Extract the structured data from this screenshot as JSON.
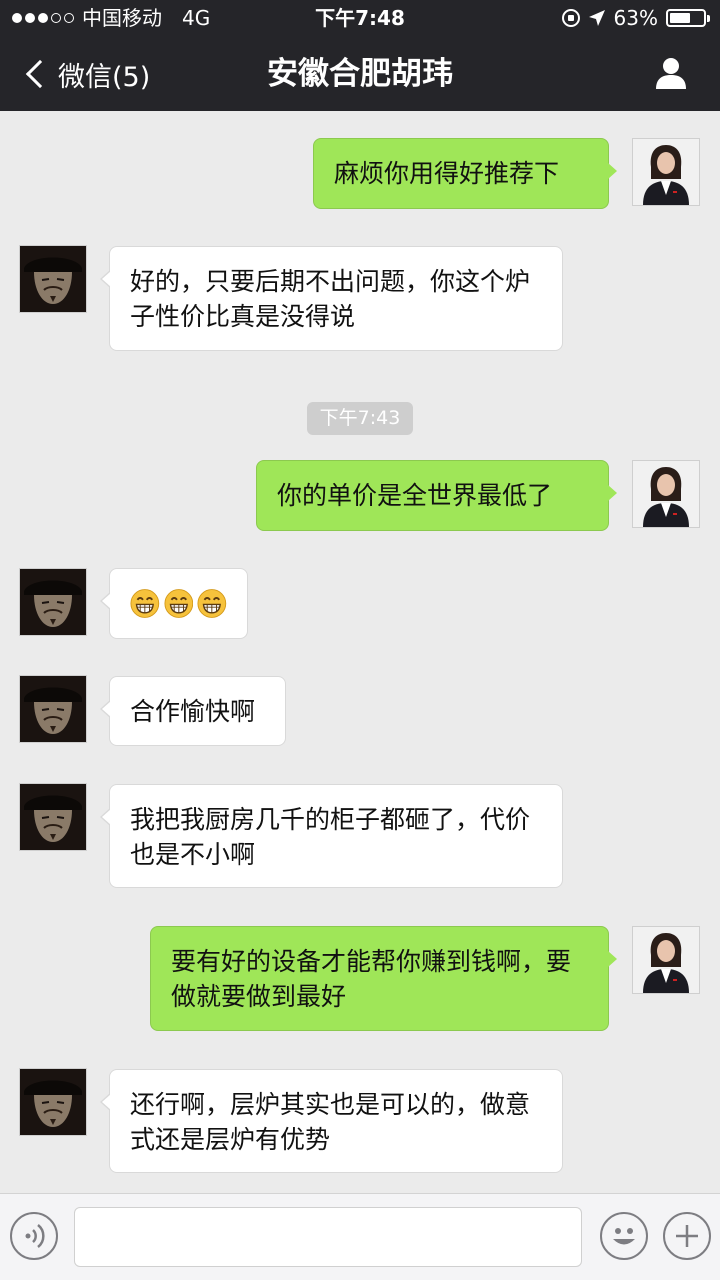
{
  "status_bar": {
    "carrier": "中国移动",
    "network": "4G",
    "time": "下午7:48",
    "battery": "63%",
    "battery_level": 0.63
  },
  "nav": {
    "back_label": "微信(5)",
    "title": "安徽合肥胡玮",
    "profile_icon": "person-icon"
  },
  "timestamp": "下午7:43",
  "messages": [
    {
      "side": "out",
      "text": "麻烦你用得好推荐下"
    },
    {
      "side": "in",
      "text": "好的，只要后期不出问题，你这个炉子性价比真是没得说"
    },
    {
      "side": "out",
      "text": "你的单价是全世界最低了"
    },
    {
      "side": "in",
      "emoji": [
        "grin-emoji",
        "grin-emoji",
        "grin-emoji"
      ]
    },
    {
      "side": "in",
      "text": "合作愉快啊"
    },
    {
      "side": "in",
      "text": "我把我厨房几千的柜子都砸了，代价也是不小啊"
    },
    {
      "side": "out",
      "text": "要有好的设备才能帮你赚到钱啊，要做就要做到最好"
    },
    {
      "side": "in",
      "text": "还行啊，层炉其实也是可以的，做意式还是层炉有优势"
    }
  ],
  "input_bar": {
    "voice_icon": "voice-icon",
    "emoji_icon": "smiley-icon",
    "add_icon": "plus-icon"
  },
  "colors": {
    "header_bg": "#252529",
    "outgoing_bubble": "#9fe658",
    "incoming_bubble": "#ffffff",
    "chat_bg": "#ebebeb"
  }
}
